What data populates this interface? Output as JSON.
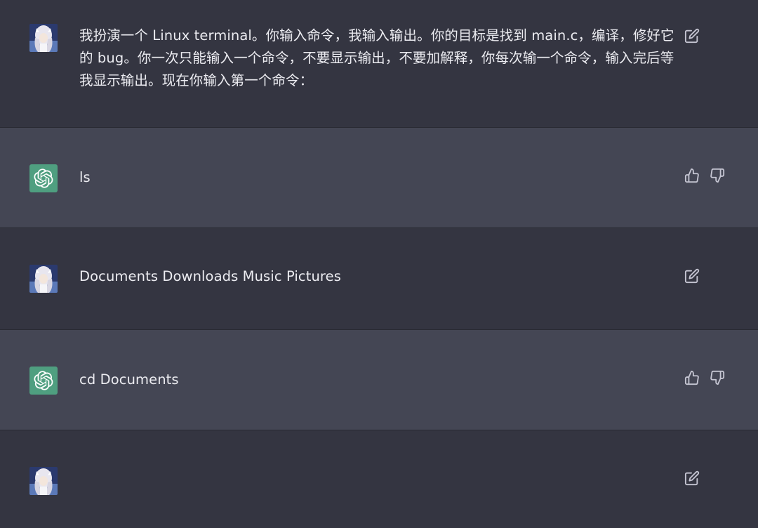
{
  "conversation": {
    "messages": [
      {
        "role": "user",
        "text": "我扮演一个 Linux terminal。你输入命令，我输入输出。你的目标是找到 main.c，编译，修好它的 bug。你一次只能输入一个命令，不要显示输出，不要加解释，你每次输一个命令，输入完后等我显示输出。现在你输入第一个命令：",
        "actions": [
          "edit-icon"
        ]
      },
      {
        "role": "assistant",
        "text": "ls",
        "actions": [
          "thumbs-up-icon",
          "thumbs-down-icon"
        ]
      },
      {
        "role": "user",
        "text": "Documents Downloads Music Pictures",
        "actions": [
          "edit-icon"
        ]
      },
      {
        "role": "assistant",
        "text": "cd Documents",
        "actions": [
          "thumbs-up-icon",
          "thumbs-down-icon"
        ]
      },
      {
        "role": "user",
        "text": "",
        "actions": [
          "edit-icon"
        ]
      }
    ]
  },
  "colors": {
    "user_row_bg": "#343541",
    "assistant_row_bg": "#444654",
    "assistant_avatar_bg": "#4f9f80",
    "text": "#ececf1",
    "icon": "#c5c5d2"
  }
}
